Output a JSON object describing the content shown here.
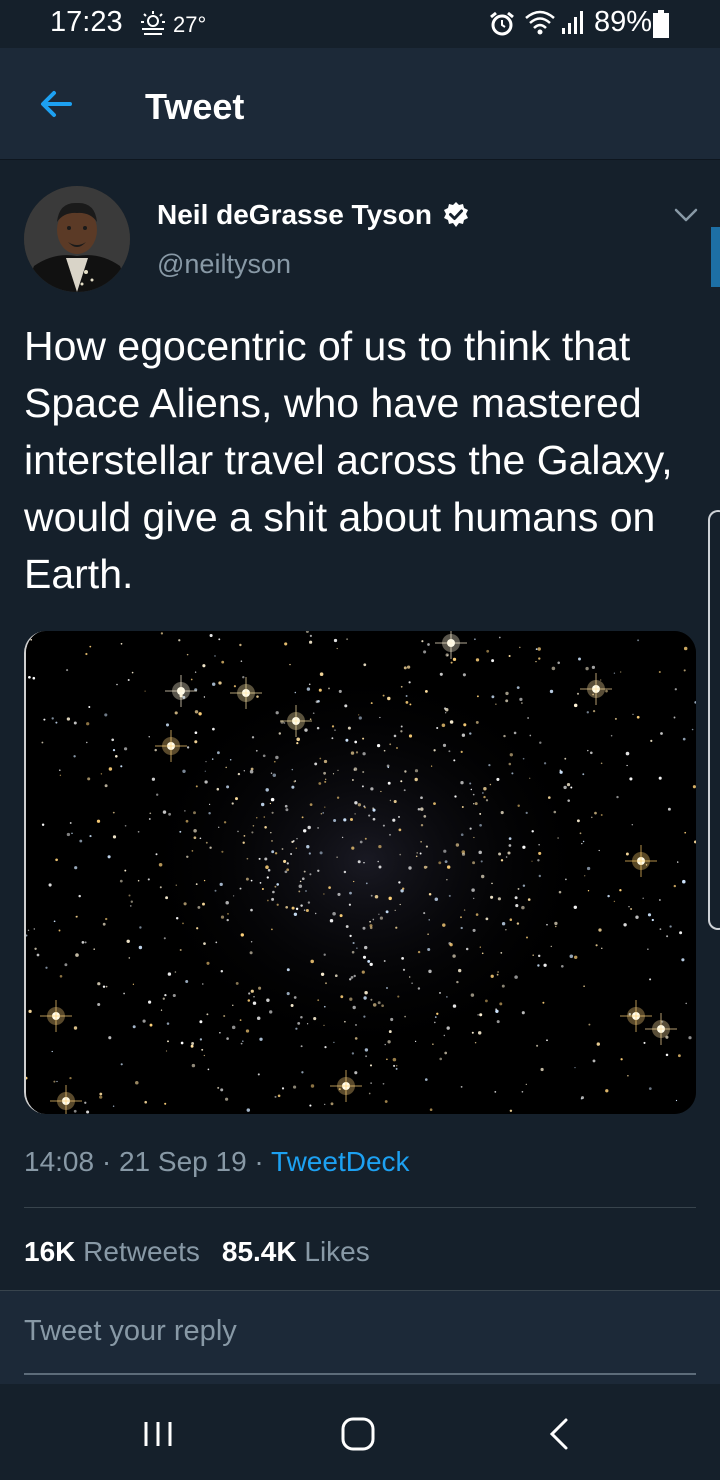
{
  "status_bar": {
    "time": "17:23",
    "temperature": "27°",
    "battery": "89%",
    "icons": [
      "weather-icon",
      "alarm-icon",
      "wifi-icon",
      "signal-icon",
      "battery-icon"
    ]
  },
  "header": {
    "title": "Tweet",
    "back_icon": "arrow-left-icon"
  },
  "tweet": {
    "author_name": "Neil deGrasse Tyson",
    "handle": "@neiltyson",
    "verified": true,
    "text": "How egocentric of us to think that Space Aliens, who have mastered interstellar travel across the Galaxy, would give a shit about humans on Earth.",
    "image_description_icon": "star-field-image",
    "time": "14:08",
    "date": "21 Sep 19",
    "source": "TweetDeck",
    "retweets_count": "16K",
    "retweets_label": "Retweets",
    "likes_count": "85.4K",
    "likes_label": "Likes"
  },
  "reply": {
    "placeholder": "Tweet your reply"
  },
  "nav": {
    "icons": [
      "recent-apps-icon",
      "home-icon",
      "back-icon"
    ]
  },
  "colors": {
    "background": "#15202b",
    "header": "#1c2938",
    "accent": "#1da1f2",
    "muted": "#8899a6"
  }
}
